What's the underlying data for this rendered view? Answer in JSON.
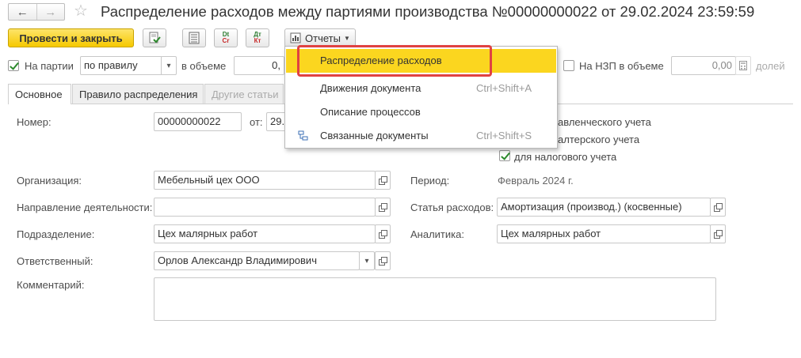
{
  "window": {
    "title": "Распределение расходов между партиями производства №00000000022 от 29.02.2024 23:59:59"
  },
  "nav": {
    "back_icon": "arrow-left",
    "forward_icon": "arrow-right",
    "favorite_icon": "star"
  },
  "toolbar": {
    "post_close_label": "Провести и закрыть",
    "reports_label": "Отчеты"
  },
  "options_row": {
    "on_batches_label": "На партии",
    "on_batches_checked": true,
    "rule_value": "по правилу",
    "volume_label": "в объеме",
    "volume_value": "0,",
    "wip_label": "На НЗП в объеме",
    "wip_checked": false,
    "wip_value": "0,00",
    "shares_label": "долей"
  },
  "tabs": [
    {
      "label": "Основное",
      "active": true
    },
    {
      "label": "Правило распределения",
      "active": false
    },
    {
      "label": "Другие статьи",
      "active": false,
      "disabled": true
    }
  ],
  "form": {
    "number_label": "Номер:",
    "number_value": "00000000022",
    "date_label": "от:",
    "date_value": "29.",
    "mgmt_label_partial": "авленческого учета",
    "acc_label_partial": "алтерского учета",
    "tax_label": "для налогового учета",
    "tax_checked": true,
    "org_label": "Организация:",
    "org_value": "Мебельный цех ООО",
    "direction_label": "Направление деятельности:",
    "direction_value": "",
    "dept_label": "Подразделение:",
    "dept_value": "Цех малярных работ",
    "resp_label": "Ответственный:",
    "resp_value": "Орлов Александр Владимирович",
    "comment_label": "Комментарий:",
    "comment_value": "",
    "period_label": "Период:",
    "period_value": "Февраль 2024 г.",
    "expense_label": "Статья расходов:",
    "expense_value": "Амортизация (производ.) (косвенные)",
    "analytics_label": "Аналитика:",
    "analytics_value": "Цех малярных работ"
  },
  "reports_menu": {
    "items": [
      {
        "label": "Распределение расходов",
        "shortcut": "",
        "highlighted": true
      },
      {
        "label": "Движения документа",
        "shortcut": "Ctrl+Shift+A"
      },
      {
        "label": "Описание процессов",
        "shortcut": ""
      },
      {
        "label": "Связанные документы",
        "shortcut": "Ctrl+Shift+S",
        "icon": "structure-icon"
      }
    ]
  },
  "colors": {
    "primary_button": "#f6c900",
    "highlight": "#fbd61f",
    "callout": "#e04242"
  }
}
